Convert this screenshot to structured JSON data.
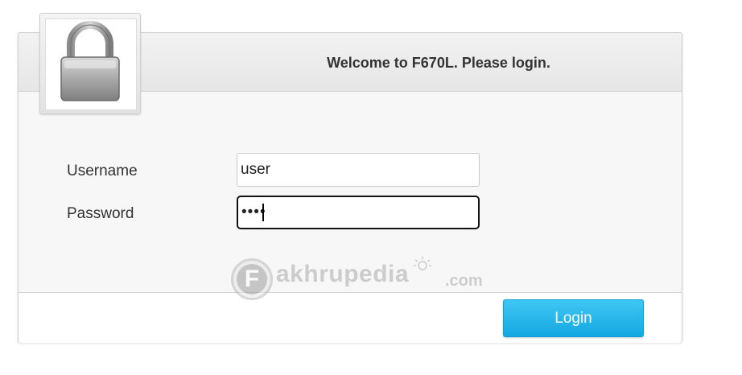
{
  "header": {
    "title": "Welcome to F670L. Please login.",
    "icon": "lock-icon"
  },
  "form": {
    "username_label": "Username",
    "username_value": "user",
    "password_label": "Password",
    "password_value": "••••"
  },
  "footer": {
    "login_label": "Login"
  },
  "watermark": {
    "logo_letter": "F",
    "name": "akhrupedia",
    "tld": ".com"
  },
  "colors": {
    "accent": "#1fb2e8",
    "header_bg": "#ececec",
    "text": "#333333"
  }
}
